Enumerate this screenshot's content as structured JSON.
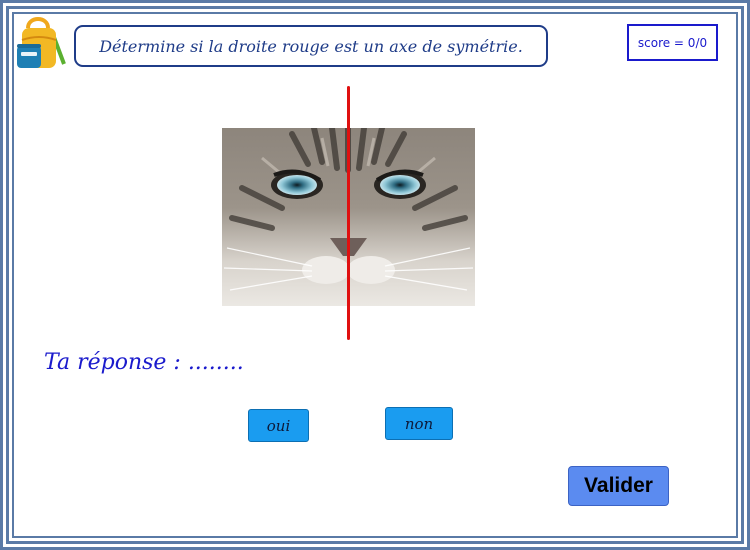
{
  "header": {
    "instruction": "Détermine si la droite rouge est un axe de symétrie.",
    "score": "score = 0/0",
    "logo_icon": "backpack-icon"
  },
  "main": {
    "image_icon": "cat-face-image",
    "axis_color": "#e01010",
    "answer_label": "Ta réponse : ........"
  },
  "buttons": {
    "yes_label": "oui",
    "no_label": "non",
    "validate_label": "Valider"
  },
  "colors": {
    "frame": "#5a7aa6",
    "text_blue": "#1a1acc",
    "choice_button": "#1a9cf0",
    "validate_button": "#5b8bf0"
  }
}
